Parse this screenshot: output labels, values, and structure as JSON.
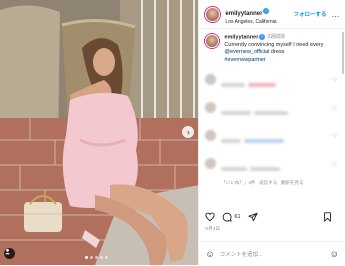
{
  "post": {
    "username": "emilyytanner",
    "location": "Los Angeles, California",
    "follow_label": "フォローする",
    "more_label": "…"
  },
  "caption": {
    "username": "emilyytanner",
    "time": "2週間前",
    "text_prefix": "Currently convincing myself I need every ",
    "mention": "@evernew_official",
    "text_suffix": " dress",
    "hashtag": "#evernewpartner"
  },
  "comment_meta": {
    "reply_label": "返信する",
    "likes_label": "「いいね！」4件",
    "translate_label": "翻訳を見る"
  },
  "actions": {
    "likes_count": "61",
    "date": "6月4日"
  },
  "add_comment": {
    "placeholder": "コメントを追加..."
  },
  "carousel": {
    "total": 5,
    "current": 1
  },
  "colors": {
    "accent": "#0095f6",
    "link": "#00376b",
    "muted": "#8e8e8e"
  }
}
